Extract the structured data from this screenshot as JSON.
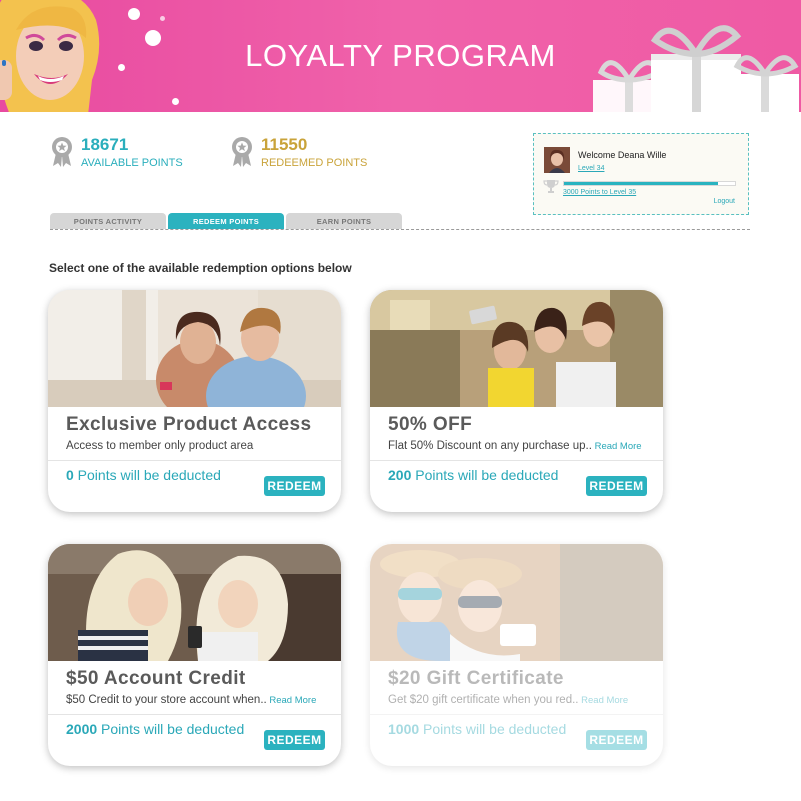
{
  "header": {
    "title": "LOYALTY PROGRAM",
    "color": "#ee5aa6"
  },
  "stats": {
    "available": {
      "value": "18671",
      "label": "AVAILABLE POINTS",
      "color": "#2aaebc"
    },
    "redeemed": {
      "value": "11550",
      "label": "REDEEMED POINTS",
      "color": "#c9a33a"
    }
  },
  "welcome": {
    "greeting": "Welcome Deana Wille",
    "level": "Level 34",
    "progress_percent": 90,
    "next_level": "3000 Points to Level 35",
    "logout": "Logout"
  },
  "tabs": [
    {
      "label": "POINTS ACTIVITY",
      "active": false
    },
    {
      "label": "REDEEM POINTS",
      "active": true
    },
    {
      "label": "EARN POINTS",
      "active": false
    }
  ],
  "prompt": "Select one of the available redemption options below",
  "cards": [
    {
      "title": "Exclusive Product Access",
      "desc": "Access to member only product area",
      "read_more": "",
      "points": "0",
      "points_suffix": " Points will be deducted",
      "button": "REDEEM",
      "disabled": false
    },
    {
      "title": "50% OFF",
      "desc": "Flat 50% Discount on any purchase up..",
      "read_more": " Read More",
      "points": "200",
      "points_suffix": " Points will be deducted",
      "button": "REDEEM",
      "disabled": false
    },
    {
      "title": "$50 Account Credit",
      "desc": "$50 Credit to your store account when..",
      "read_more": " Read More",
      "points": "2000",
      "points_suffix": " Points will be deducted",
      "button": "REDEEM",
      "disabled": false
    },
    {
      "title": "$20 Gift Certificate",
      "desc": "Get $20 gift certificate when you red..",
      "read_more": " Read More",
      "points": "1000",
      "points_suffix": " Points will be deducted",
      "button": "REDEEM",
      "disabled": true
    }
  ],
  "colors": {
    "accent": "#2bb2bf",
    "pink": "#ee5aa6",
    "gold": "#c9a33a"
  }
}
